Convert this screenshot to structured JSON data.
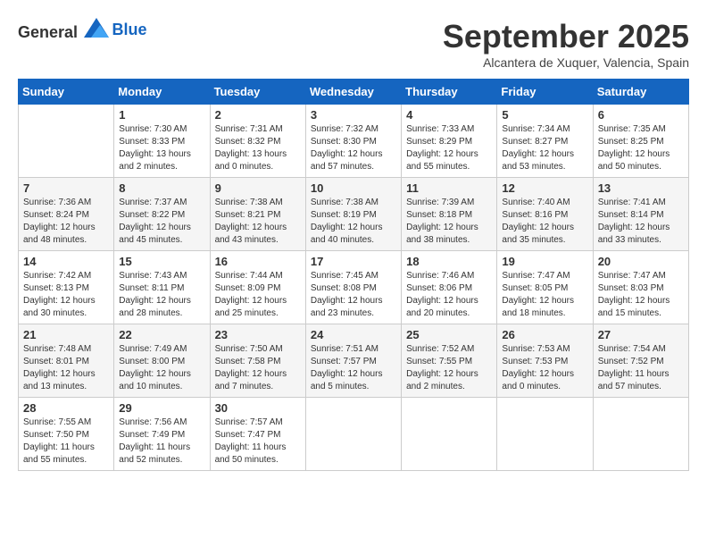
{
  "header": {
    "logo_general": "General",
    "logo_blue": "Blue",
    "month": "September 2025",
    "location": "Alcantera de Xuquer, Valencia, Spain"
  },
  "weekdays": [
    "Sunday",
    "Monday",
    "Tuesday",
    "Wednesday",
    "Thursday",
    "Friday",
    "Saturday"
  ],
  "weeks": [
    [
      {
        "day": "",
        "text": ""
      },
      {
        "day": "1",
        "text": "Sunrise: 7:30 AM\nSunset: 8:33 PM\nDaylight: 13 hours\nand 2 minutes."
      },
      {
        "day": "2",
        "text": "Sunrise: 7:31 AM\nSunset: 8:32 PM\nDaylight: 13 hours\nand 0 minutes."
      },
      {
        "day": "3",
        "text": "Sunrise: 7:32 AM\nSunset: 8:30 PM\nDaylight: 12 hours\nand 57 minutes."
      },
      {
        "day": "4",
        "text": "Sunrise: 7:33 AM\nSunset: 8:29 PM\nDaylight: 12 hours\nand 55 minutes."
      },
      {
        "day": "5",
        "text": "Sunrise: 7:34 AM\nSunset: 8:27 PM\nDaylight: 12 hours\nand 53 minutes."
      },
      {
        "day": "6",
        "text": "Sunrise: 7:35 AM\nSunset: 8:25 PM\nDaylight: 12 hours\nand 50 minutes."
      }
    ],
    [
      {
        "day": "7",
        "text": "Sunrise: 7:36 AM\nSunset: 8:24 PM\nDaylight: 12 hours\nand 48 minutes."
      },
      {
        "day": "8",
        "text": "Sunrise: 7:37 AM\nSunset: 8:22 PM\nDaylight: 12 hours\nand 45 minutes."
      },
      {
        "day": "9",
        "text": "Sunrise: 7:38 AM\nSunset: 8:21 PM\nDaylight: 12 hours\nand 43 minutes."
      },
      {
        "day": "10",
        "text": "Sunrise: 7:38 AM\nSunset: 8:19 PM\nDaylight: 12 hours\nand 40 minutes."
      },
      {
        "day": "11",
        "text": "Sunrise: 7:39 AM\nSunset: 8:18 PM\nDaylight: 12 hours\nand 38 minutes."
      },
      {
        "day": "12",
        "text": "Sunrise: 7:40 AM\nSunset: 8:16 PM\nDaylight: 12 hours\nand 35 minutes."
      },
      {
        "day": "13",
        "text": "Sunrise: 7:41 AM\nSunset: 8:14 PM\nDaylight: 12 hours\nand 33 minutes."
      }
    ],
    [
      {
        "day": "14",
        "text": "Sunrise: 7:42 AM\nSunset: 8:13 PM\nDaylight: 12 hours\nand 30 minutes."
      },
      {
        "day": "15",
        "text": "Sunrise: 7:43 AM\nSunset: 8:11 PM\nDaylight: 12 hours\nand 28 minutes."
      },
      {
        "day": "16",
        "text": "Sunrise: 7:44 AM\nSunset: 8:09 PM\nDaylight: 12 hours\nand 25 minutes."
      },
      {
        "day": "17",
        "text": "Sunrise: 7:45 AM\nSunset: 8:08 PM\nDaylight: 12 hours\nand 23 minutes."
      },
      {
        "day": "18",
        "text": "Sunrise: 7:46 AM\nSunset: 8:06 PM\nDaylight: 12 hours\nand 20 minutes."
      },
      {
        "day": "19",
        "text": "Sunrise: 7:47 AM\nSunset: 8:05 PM\nDaylight: 12 hours\nand 18 minutes."
      },
      {
        "day": "20",
        "text": "Sunrise: 7:47 AM\nSunset: 8:03 PM\nDaylight: 12 hours\nand 15 minutes."
      }
    ],
    [
      {
        "day": "21",
        "text": "Sunrise: 7:48 AM\nSunset: 8:01 PM\nDaylight: 12 hours\nand 13 minutes."
      },
      {
        "day": "22",
        "text": "Sunrise: 7:49 AM\nSunset: 8:00 PM\nDaylight: 12 hours\nand 10 minutes."
      },
      {
        "day": "23",
        "text": "Sunrise: 7:50 AM\nSunset: 7:58 PM\nDaylight: 12 hours\nand 7 minutes."
      },
      {
        "day": "24",
        "text": "Sunrise: 7:51 AM\nSunset: 7:57 PM\nDaylight: 12 hours\nand 5 minutes."
      },
      {
        "day": "25",
        "text": "Sunrise: 7:52 AM\nSunset: 7:55 PM\nDaylight: 12 hours\nand 2 minutes."
      },
      {
        "day": "26",
        "text": "Sunrise: 7:53 AM\nSunset: 7:53 PM\nDaylight: 12 hours\nand 0 minutes."
      },
      {
        "day": "27",
        "text": "Sunrise: 7:54 AM\nSunset: 7:52 PM\nDaylight: 11 hours\nand 57 minutes."
      }
    ],
    [
      {
        "day": "28",
        "text": "Sunrise: 7:55 AM\nSunset: 7:50 PM\nDaylight: 11 hours\nand 55 minutes."
      },
      {
        "day": "29",
        "text": "Sunrise: 7:56 AM\nSunset: 7:49 PM\nDaylight: 11 hours\nand 52 minutes."
      },
      {
        "day": "30",
        "text": "Sunrise: 7:57 AM\nSunset: 7:47 PM\nDaylight: 11 hours\nand 50 minutes."
      },
      {
        "day": "",
        "text": ""
      },
      {
        "day": "",
        "text": ""
      },
      {
        "day": "",
        "text": ""
      },
      {
        "day": "",
        "text": ""
      }
    ]
  ]
}
